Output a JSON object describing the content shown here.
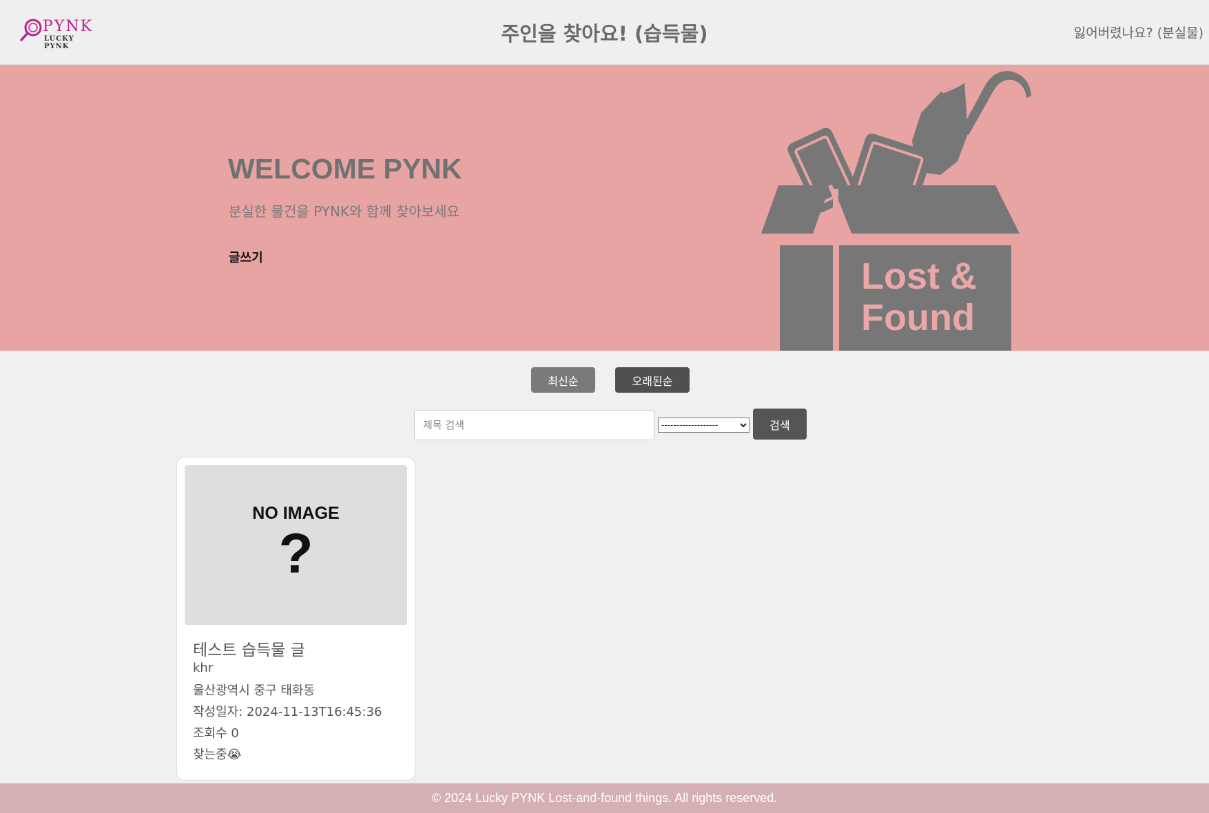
{
  "header": {
    "logo": {
      "brand": "PYNK",
      "sub": "LUCKY PYNK"
    },
    "title": "주인을 찾아요! (습득물)",
    "lost_link": "잃어버렸나요? (분실물)"
  },
  "hero": {
    "title": "WELCOME PYNK",
    "subtitle": "분실한 물건을 PYNK와 함께 찾아보세요",
    "write_link": "글쓰기",
    "art": {
      "line1": "Lost &",
      "line2": "Found"
    },
    "bg_color": "#e8a3a3"
  },
  "sort": {
    "newest_label": "최신순",
    "oldest_label": "오래된순"
  },
  "search": {
    "placeholder": "제목 검색",
    "value": "",
    "category_selected": "-------------------",
    "button_label": "검색"
  },
  "posts": [
    {
      "image": {
        "line1": "NO IMAGE",
        "line2": "?"
      },
      "title": "테스트 습득물 글",
      "author": "khr",
      "location": "울산광역시 중구 태화동",
      "date": "작성일자: 2024-11-13T16:45:36",
      "views": "조회수 0",
      "status": "찾는중😭"
    }
  ],
  "footer": {
    "text": "© 2024 Lucky PYNK Lost-and-found things. All rights reserved."
  },
  "colors": {
    "accent": "#c0208a",
    "hero": "#e8a3a3",
    "footer": "#d4b0b2",
    "art_gray": "#777777"
  }
}
